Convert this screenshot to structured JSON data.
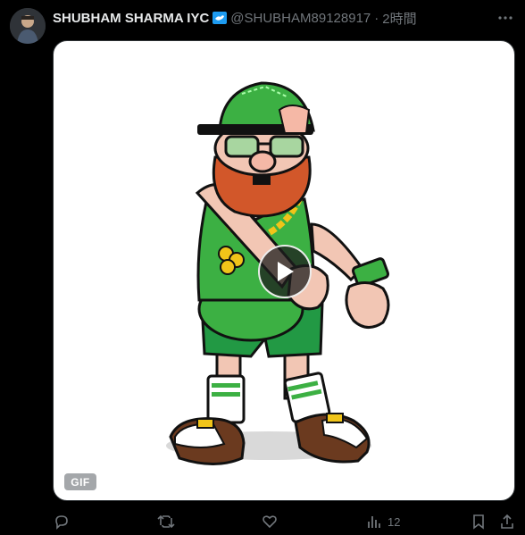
{
  "tweet": {
    "author_name": "SHUBHAM SHARMA IYC",
    "handle": "@SHUBHAM89128917",
    "separator": "·",
    "time": "2時間",
    "verified_color": "#1d9bf0",
    "more_icon": "more-icon"
  },
  "media": {
    "type_badge": "GIF",
    "play_icon": "play-icon",
    "description": "Cartoon leprechaun dancing"
  },
  "actions": {
    "reply_count": "",
    "retweet_count": "",
    "like_count": "",
    "views_count": "12",
    "icons": [
      "reply-icon",
      "retweet-icon",
      "like-icon",
      "views-icon",
      "bookmark-icon",
      "share-icon"
    ]
  }
}
